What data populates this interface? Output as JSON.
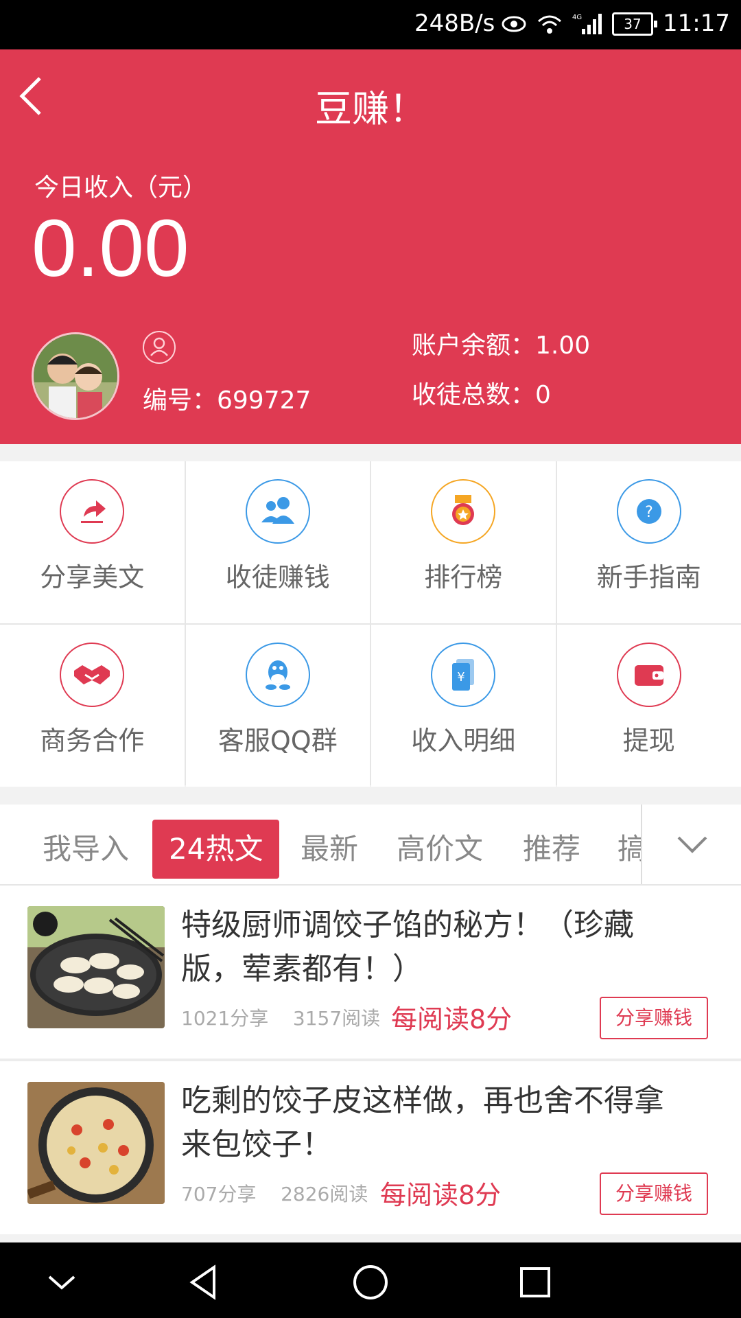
{
  "status_bar": {
    "network_speed": "248B/s",
    "signal_label": "4G",
    "battery": "37",
    "time": "11:17"
  },
  "header": {
    "title": "豆赚！",
    "today_income_label": "今日收入（元）",
    "today_income_value": "0.00",
    "user_id": "编号：699727",
    "balance": "账户余额：1.00",
    "disciples": "收徒总数：0"
  },
  "colors": {
    "brand": "#df3a52",
    "blue": "#3b99e6",
    "orange": "#f5a623"
  },
  "grid": [
    {
      "label": "分享美文",
      "icon": "share-icon"
    },
    {
      "label": "收徒赚钱",
      "icon": "users-icon"
    },
    {
      "label": "排行榜",
      "icon": "medal-icon"
    },
    {
      "label": "新手指南",
      "icon": "question-icon"
    },
    {
      "label": "商务合作",
      "icon": "handshake-icon"
    },
    {
      "label": "客服QQ群",
      "icon": "qq-icon"
    },
    {
      "label": "收入明细",
      "icon": "receipt-icon"
    },
    {
      "label": "提现",
      "icon": "wallet-icon"
    }
  ],
  "tabs": [
    "我导入",
    "24热文",
    "最新",
    "高价文",
    "推荐",
    "搞"
  ],
  "active_tab": "24热文",
  "articles": [
    {
      "title": "特级厨师调饺子馅的秘方！（珍藏版，荤素都有！）",
      "shares": "1021分享",
      "reads": "3157阅读",
      "rate": "每阅读8分",
      "button": "分享赚钱"
    },
    {
      "title": "吃剩的饺子皮这样做，再也舍不得拿来包饺子！",
      "shares": "707分享",
      "reads": "2826阅读",
      "rate": "每阅读8分",
      "button": "分享赚钱"
    }
  ]
}
